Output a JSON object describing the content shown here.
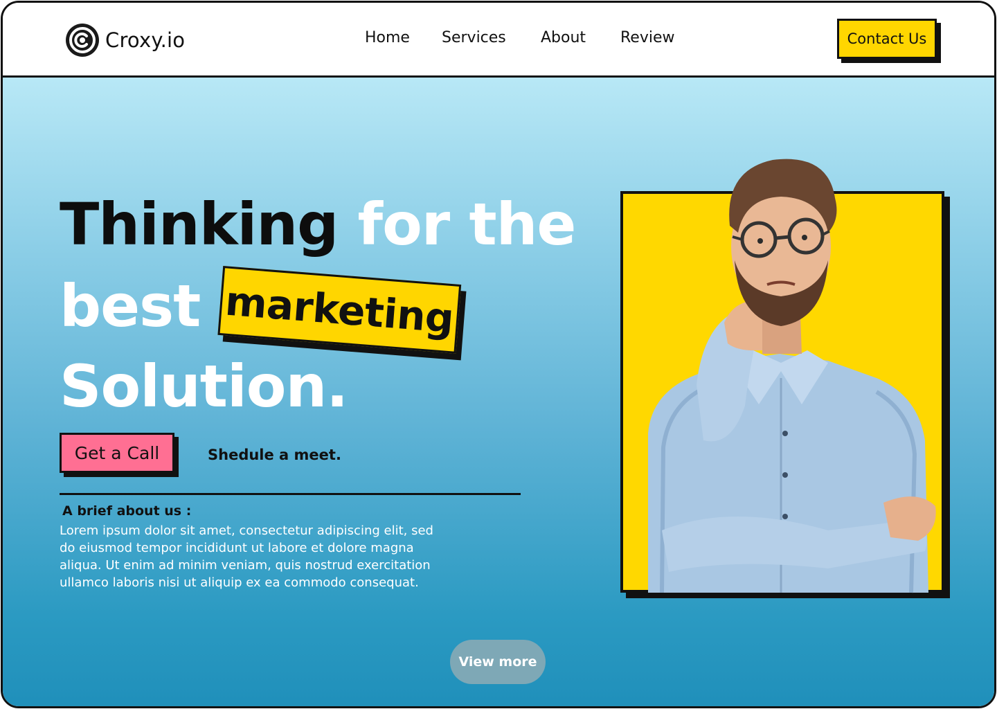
{
  "brand": {
    "name": "Croxy.io",
    "icon": "croxy-logo-icon"
  },
  "nav": {
    "items": [
      {
        "label": "Home"
      },
      {
        "label": "Services"
      },
      {
        "label": "About"
      },
      {
        "label": "Review"
      }
    ],
    "contact_label": "Contact Us"
  },
  "hero": {
    "headline": {
      "part1": "Thinking",
      "part2": "for the",
      "part3": "best",
      "highlight": "marketing",
      "part4": "Solution."
    },
    "cta_label": "Get a Call",
    "secondary_label": "Shedule a meet.",
    "about_title": "A brief about us :",
    "about_text": "Lorem ipsum dolor sit amet, consectetur adipiscing elit, sed do eiusmod tempor incididunt ut labore et dolore magna aliqua. Ut enim ad minim veniam, quis nostrud exercitation ullamco laboris nisi ut aliquip ex ea commodo consequat.",
    "view_more_label": "View more"
  },
  "colors": {
    "accent_yellow": "#ffd600",
    "cta_pink": "#ff6f93",
    "gradient_top": "#b8e8f6",
    "gradient_bottom": "#1f8fba",
    "ink": "#111111"
  }
}
